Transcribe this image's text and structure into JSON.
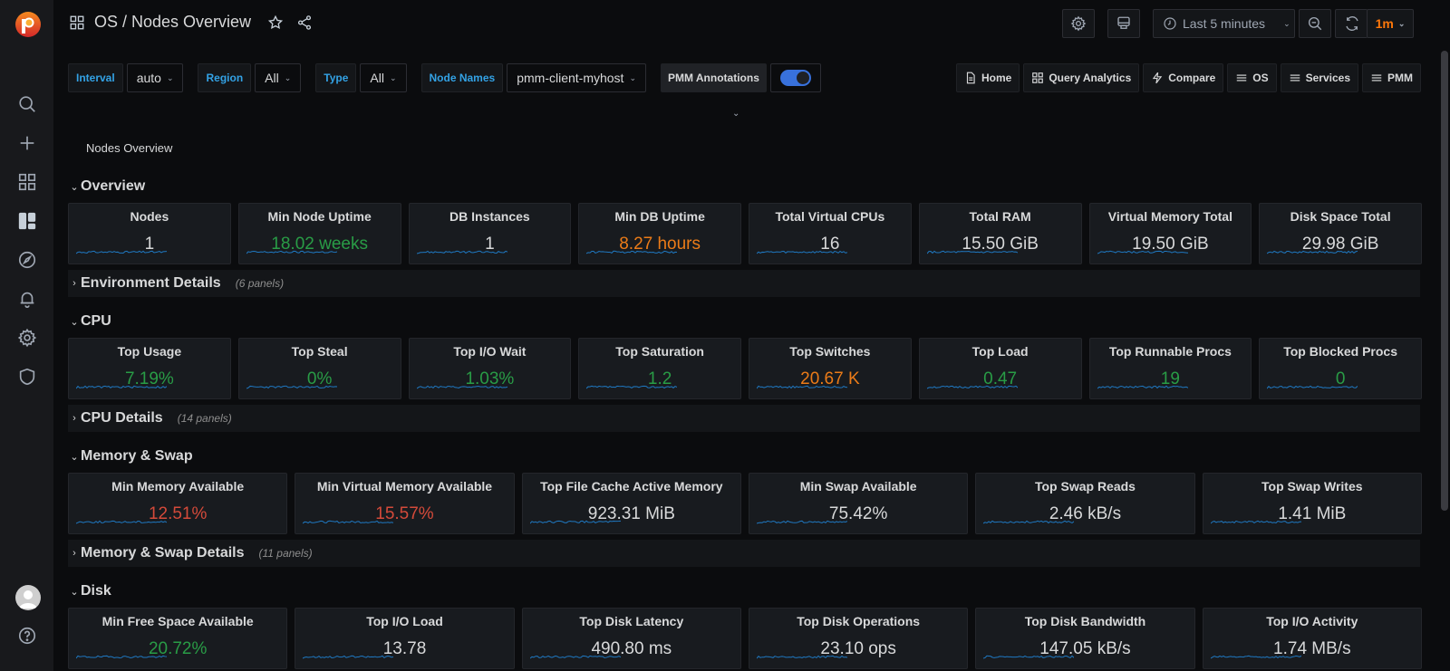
{
  "app": {
    "title": "OS / Nodes Overview",
    "brand_color": "#e8542a"
  },
  "sidebar": {
    "items": [
      {
        "name": "search",
        "icon": "search-icon"
      },
      {
        "name": "create",
        "icon": "plus-icon"
      },
      {
        "name": "dashboards",
        "icon": "apps-icon"
      },
      {
        "name": "pmm-dashboards",
        "icon": "layout-icon"
      },
      {
        "name": "explore",
        "icon": "compass-icon"
      },
      {
        "name": "alerting",
        "icon": "bell-icon"
      },
      {
        "name": "configuration",
        "icon": "gear-icon"
      },
      {
        "name": "server-admin",
        "icon": "shield-icon"
      }
    ],
    "bottom": [
      {
        "name": "profile",
        "icon": "avatar-icon"
      },
      {
        "name": "help",
        "icon": "help-icon"
      }
    ]
  },
  "toolbar": {
    "time_range": "Last 5 minutes",
    "refresh_interval": "1m",
    "refresh_color": "#ff780a"
  },
  "variables": [
    {
      "label": "Interval",
      "value": "auto"
    },
    {
      "label": "Region",
      "value": "All"
    },
    {
      "label": "Type",
      "value": "All"
    },
    {
      "label": "Node Names",
      "value": "pmm-client-myhost"
    }
  ],
  "annotations": {
    "label": "PMM Annotations",
    "enabled": true
  },
  "links": [
    {
      "label": "Home",
      "icon": "doc-icon"
    },
    {
      "label": "Query Analytics",
      "icon": "apps-icon"
    },
    {
      "label": "Compare",
      "icon": "bolt-icon"
    },
    {
      "label": "OS",
      "icon": "bars-icon"
    },
    {
      "label": "Services",
      "icon": "bars-icon"
    },
    {
      "label": "PMM",
      "icon": "bars-icon"
    }
  ],
  "text_panel": "Nodes Overview",
  "rows": {
    "overview": {
      "title": "Overview",
      "panels": [
        {
          "title": "Nodes",
          "value": "1",
          "color": "white"
        },
        {
          "title": "Min Node Uptime",
          "value": "18.02 weeks",
          "color": "green"
        },
        {
          "title": "DB Instances",
          "value": "1",
          "color": "white"
        },
        {
          "title": "Min DB Uptime",
          "value": "8.27 hours",
          "color": "orange"
        },
        {
          "title": "Total Virtual CPUs",
          "value": "16",
          "color": "white"
        },
        {
          "title": "Total RAM",
          "value": "15.50 GiB",
          "color": "white"
        },
        {
          "title": "Virtual Memory Total",
          "value": "19.50 GiB",
          "color": "white"
        },
        {
          "title": "Disk Space Total",
          "value": "29.98 GiB",
          "color": "white"
        }
      ]
    },
    "environment": {
      "title": "Environment Details",
      "count": "(6 panels)"
    },
    "cpu": {
      "title": "CPU",
      "panels": [
        {
          "title": "Top Usage",
          "value": "7.19%",
          "color": "green"
        },
        {
          "title": "Top Steal",
          "value": "0%",
          "color": "green"
        },
        {
          "title": "Top I/O Wait",
          "value": "1.03%",
          "color": "green"
        },
        {
          "title": "Top Saturation",
          "value": "1.2",
          "color": "green"
        },
        {
          "title": "Top Switches",
          "value": "20.67 K",
          "color": "orange"
        },
        {
          "title": "Top Load",
          "value": "0.47",
          "color": "green"
        },
        {
          "title": "Top Runnable Procs",
          "value": "19",
          "color": "green"
        },
        {
          "title": "Top Blocked Procs",
          "value": "0",
          "color": "green"
        }
      ]
    },
    "cpu_details": {
      "title": "CPU Details",
      "count": "(14 panels)"
    },
    "memory": {
      "title": "Memory & Swap",
      "panels": [
        {
          "title": "Min Memory Available",
          "value": "12.51%",
          "color": "red"
        },
        {
          "title": "Min Virtual Memory Available",
          "value": "15.57%",
          "color": "red"
        },
        {
          "title": "Top File Cache Active Memory",
          "value": "923.31 MiB",
          "color": "white"
        },
        {
          "title": "Min Swap Available",
          "value": "75.42%",
          "color": "white"
        },
        {
          "title": "Top Swap Reads",
          "value": "2.46 kB/s",
          "color": "white"
        },
        {
          "title": "Top Swap Writes",
          "value": "1.41 MiB",
          "color": "white"
        }
      ]
    },
    "memory_details": {
      "title": "Memory & Swap Details",
      "count": "(11 panels)"
    },
    "disk": {
      "title": "Disk",
      "panels": [
        {
          "title": "Min Free Space Available",
          "value": "20.72%",
          "color": "green"
        },
        {
          "title": "Top I/O Load",
          "value": "13.78",
          "color": "white"
        },
        {
          "title": "Top Disk Latency",
          "value": "490.80 ms",
          "color": "white"
        },
        {
          "title": "Top Disk Operations",
          "value": "23.10 ops",
          "color": "white"
        },
        {
          "title": "Top Disk Bandwidth",
          "value": "147.05 kB/s",
          "color": "white"
        },
        {
          "title": "Top I/O Activity",
          "value": "1.74 MB/s",
          "color": "white"
        }
      ]
    }
  }
}
